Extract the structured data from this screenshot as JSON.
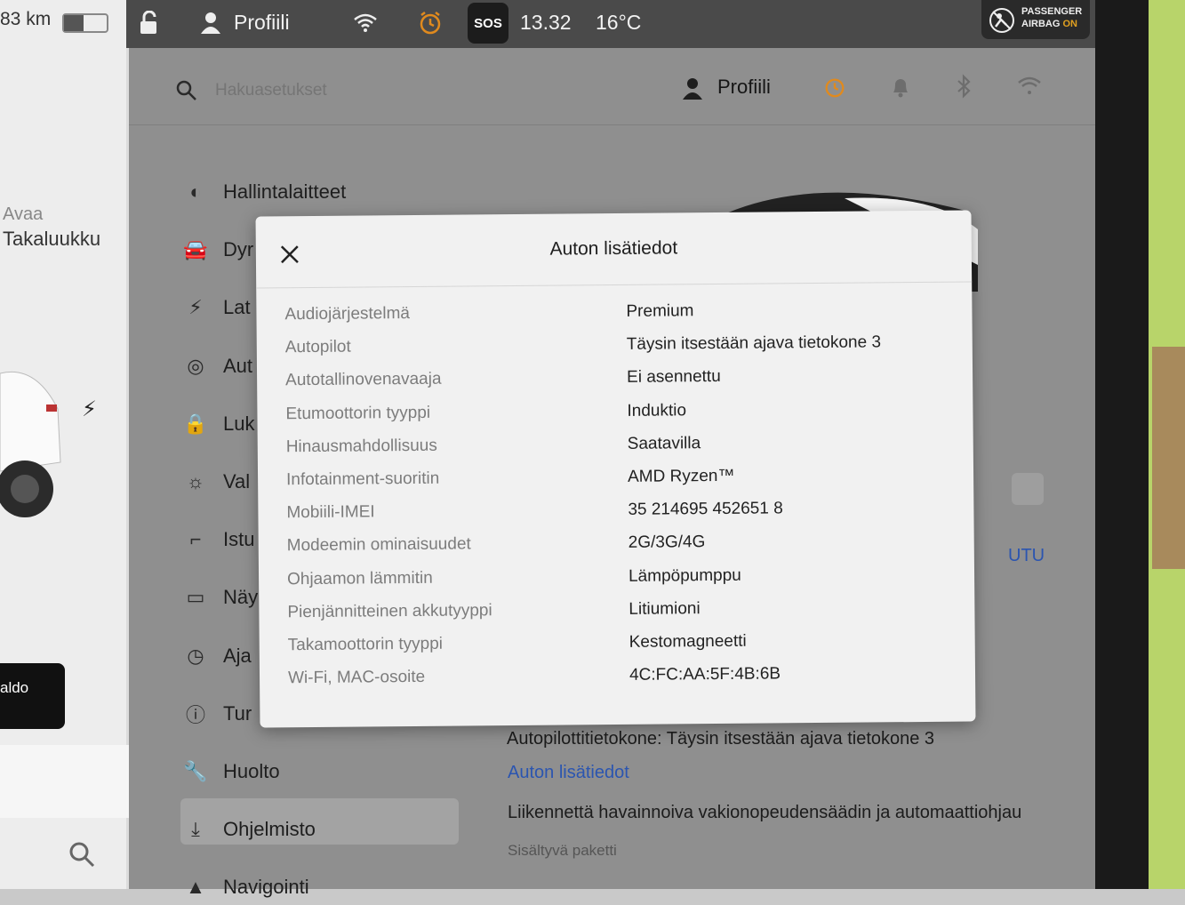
{
  "status_bar": {
    "range": "83 km",
    "profile": "Profiili",
    "sos": "SOS",
    "time": "13.32",
    "temperature": "16°C",
    "airbag_line1": "PASSENGER",
    "airbag_line2": "AIRBAG",
    "airbag_state": "ON"
  },
  "left_panel": {
    "open_label": "Avaa",
    "trunk_label": "Takaluukku",
    "button_label": "aldo"
  },
  "settings_header": {
    "search_placeholder": "Hakuasetukset",
    "profile": "Profiili"
  },
  "menu": [
    {
      "icon": "toggle-icon",
      "label": "Hallintalaitteet"
    },
    {
      "icon": "car-icon",
      "label": "Dyr"
    },
    {
      "icon": "bolt-icon",
      "label": "Lat"
    },
    {
      "icon": "steering-wheel-icon",
      "label": "Aut"
    },
    {
      "icon": "lock-icon",
      "label": "Luk"
    },
    {
      "icon": "sun-icon",
      "label": "Val"
    },
    {
      "icon": "seat-icon",
      "label": "Istu"
    },
    {
      "icon": "display-icon",
      "label": "Näy"
    },
    {
      "icon": "schedule-icon",
      "label": "Aja"
    },
    {
      "icon": "alert-icon",
      "label": "Tur"
    },
    {
      "icon": "wrench-icon",
      "label": "Huolto"
    },
    {
      "icon": "download-icon",
      "label": "Ohjelmisto"
    },
    {
      "icon": "navigation-icon",
      "label": "Navigointi"
    }
  ],
  "background_content": {
    "utu_link": "UTU",
    "autopilot_computer": "Autopilottitietokone: Täysin itsestään ajava tietokone 3",
    "details_link": "Auton lisätiedot",
    "package_title": "Liikennettä havainnoiva vakionopeudensäädin ja automaattiohjau",
    "package_subtitle": "Sisältyvä paketti"
  },
  "dialog": {
    "title": "Auton lisätiedot",
    "rows": [
      {
        "label": "Audiojärjestelmä",
        "value": "Premium"
      },
      {
        "label": "Autopilot",
        "value": "Täysin itsestään ajava tietokone 3"
      },
      {
        "label": "Autotallinovenavaaja",
        "value": "Ei asennettu"
      },
      {
        "label": "Etumoottorin tyyppi",
        "value": "Induktio"
      },
      {
        "label": "Hinausmahdollisuus",
        "value": "Saatavilla"
      },
      {
        "label": "Infotainment-suoritin",
        "value": "AMD Ryzen™"
      },
      {
        "label": "Mobiili-IMEI",
        "value": "35 214695 452651 8"
      },
      {
        "label": "Modeemin ominaisuudet",
        "value": "2G/3G/4G"
      },
      {
        "label": "Ohjaamon lämmitin",
        "value": "Lämpöpumppu"
      },
      {
        "label": "Pienjännitteinen akkutyyppi",
        "value": "Litiumioni"
      },
      {
        "label": "Takamoottorin tyyppi",
        "value": "Kestomagneetti"
      },
      {
        "label": "Wi-Fi, MAC-osoite",
        "value": "4C:FC:AA:5F:4B:6B"
      }
    ]
  },
  "colors": {
    "alarm_orange": "#e08a1e",
    "link_blue": "#2b55b0"
  }
}
